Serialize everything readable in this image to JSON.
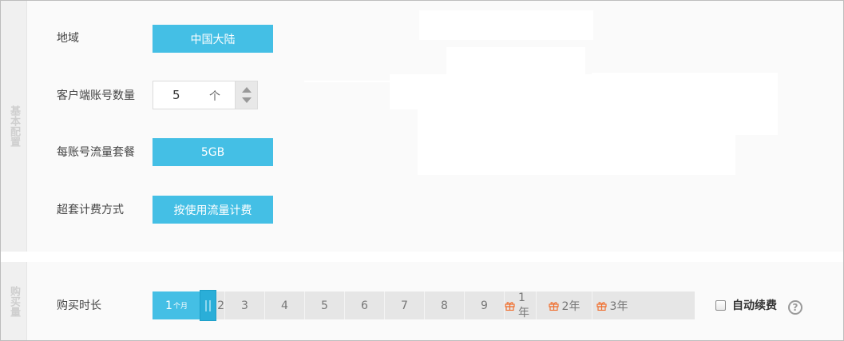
{
  "basic_config": {
    "tab_label": "基本配置",
    "region": {
      "label": "地域",
      "value": "中国大陆"
    },
    "accounts": {
      "label": "客户端账号数量",
      "value": "5",
      "unit": "个"
    },
    "traffic_plan": {
      "label": "每账号流量套餐",
      "value": "5GB"
    },
    "overage_billing": {
      "label": "超套计费方式",
      "value": "按使用流量计费"
    }
  },
  "purchase": {
    "tab_label": "购买量",
    "duration": {
      "label": "购买时长",
      "selected": "1",
      "selected_unit": "个月",
      "options": [
        "2",
        "3",
        "4",
        "5",
        "6",
        "7",
        "8",
        "9",
        "1年",
        "2年",
        "3年"
      ],
      "gift_options": [
        "1年",
        "2年",
        "3年"
      ]
    },
    "auto_renew_label": "自动续费",
    "help_symbol": "?"
  },
  "colors": {
    "accent": "#44bfe5",
    "accent_dark": "#2aaed8",
    "gift": "#f07030"
  },
  "icons": {
    "gift": "gift-icon",
    "help": "question-circle-icon",
    "stepper_up": "arrow-up-icon",
    "stepper_down": "arrow-down-icon"
  }
}
